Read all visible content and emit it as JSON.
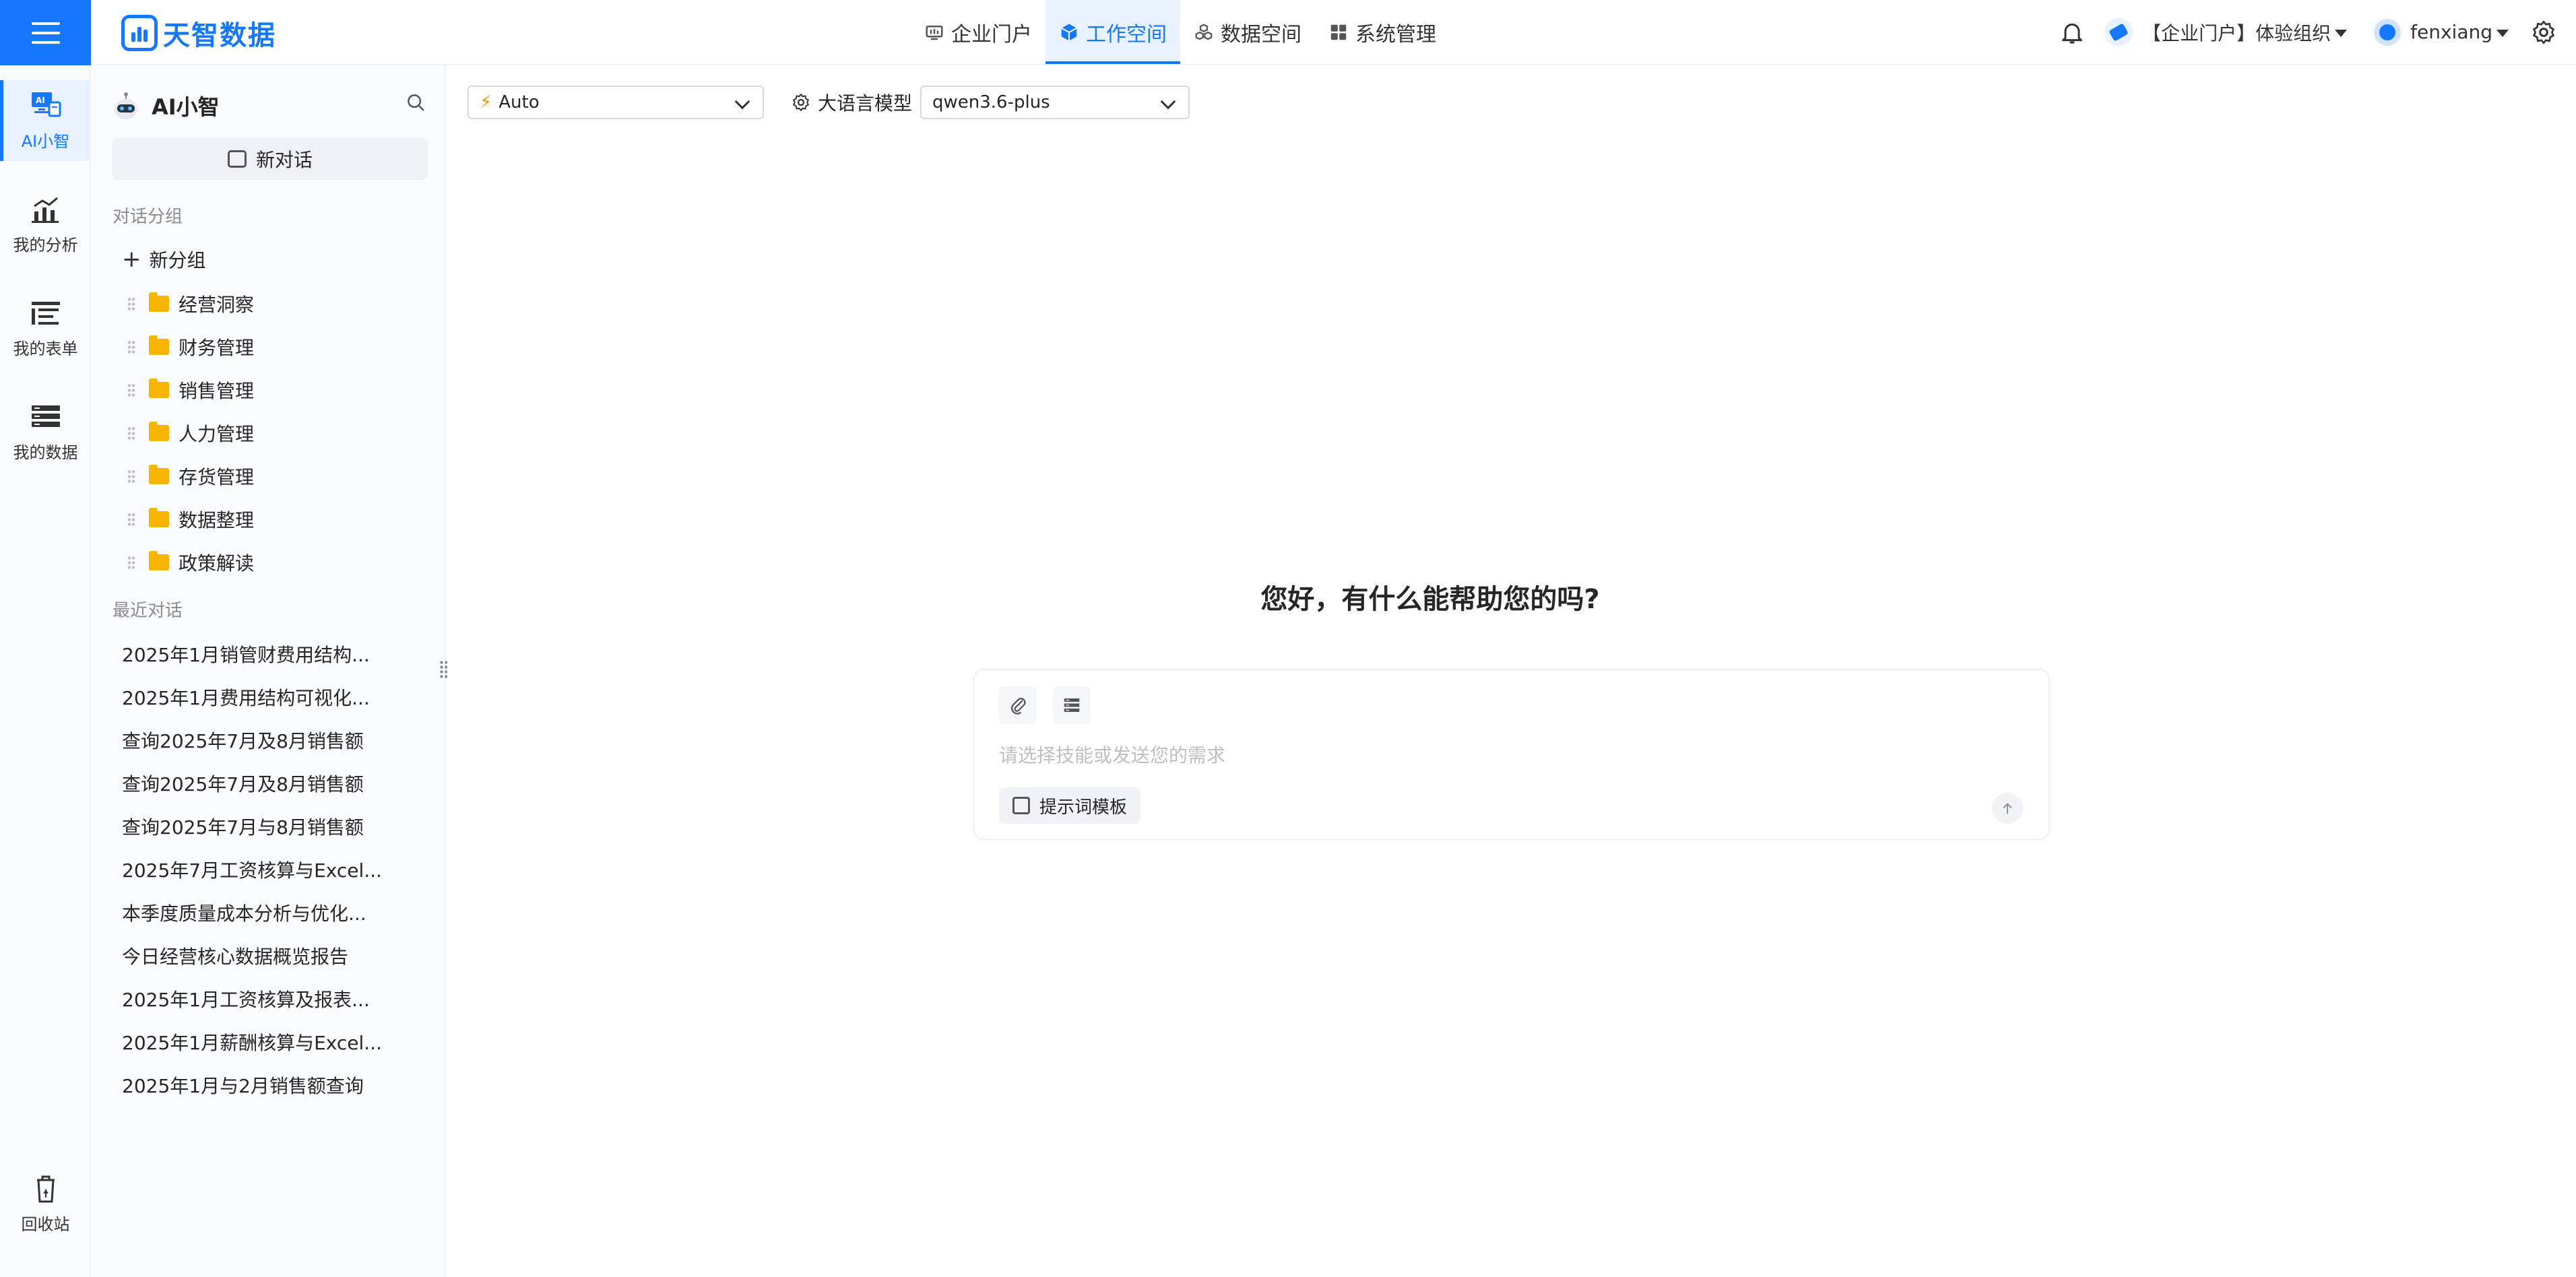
{
  "brand": {
    "name": "天智数据"
  },
  "nav": {
    "items": [
      {
        "label": "企业门户"
      },
      {
        "label": "工作空间"
      },
      {
        "label": "数据空间"
      },
      {
        "label": "系统管理"
      }
    ],
    "active": "工作空间"
  },
  "header": {
    "org_name": "【企业门户】体验组织",
    "user_name": "fenxiang"
  },
  "rail": {
    "items": [
      {
        "label": "AI小智",
        "icon": "ai-monitor-icon"
      },
      {
        "label": "我的分析",
        "icon": "chart-icon"
      },
      {
        "label": "我的表单",
        "icon": "form-icon"
      },
      {
        "label": "我的数据",
        "icon": "data-table-icon"
      },
      {
        "label": "回收站",
        "icon": "recycle-bin-icon"
      }
    ]
  },
  "sidebar": {
    "title": "AI小智",
    "new_chat_label": "新对话",
    "groups_label": "对话分组",
    "new_group_label": "新分组",
    "groups": [
      {
        "label": "经营洞察"
      },
      {
        "label": "财务管理"
      },
      {
        "label": "销售管理"
      },
      {
        "label": "人力管理"
      },
      {
        "label": "存货管理"
      },
      {
        "label": "数据整理"
      },
      {
        "label": "政策解读"
      }
    ],
    "recent_label": "最近对话",
    "recent": [
      {
        "label": "2025年1月销管财费用结构..."
      },
      {
        "label": "2025年1月费用结构可视化..."
      },
      {
        "label": "查询2025年7月及8月销售额"
      },
      {
        "label": "查询2025年7月及8月销售额"
      },
      {
        "label": "查询2025年7月与8月销售额"
      },
      {
        "label": "2025年7月工资核算与Excel..."
      },
      {
        "label": "本季度质量成本分析与优化..."
      },
      {
        "label": "今日经营核心数据概览报告"
      },
      {
        "label": "2025年1月工资核算及报表..."
      },
      {
        "label": "2025年1月薪酬核算与Excel..."
      },
      {
        "label": "2025年1月与2月销售额查询"
      }
    ]
  },
  "main": {
    "mode_select": {
      "value": "Auto"
    },
    "llm_label": "大语言模型",
    "llm_select": {
      "value": "qwen3.6-plus"
    },
    "greeting": "您好，有什么能帮助您的吗?",
    "composer": {
      "placeholder": "请选择技能或发送您的需求",
      "template_label": "提示词模板"
    }
  },
  "colors": {
    "primary": "#1677ff",
    "primary_light": "#e8f1ff",
    "folder": "#f7b500",
    "bolt": "#fa8c16"
  }
}
